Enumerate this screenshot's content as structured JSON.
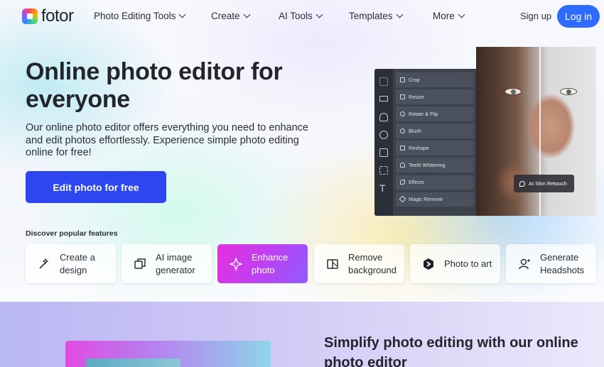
{
  "brand": {
    "name": "fotor"
  },
  "nav": {
    "items": [
      {
        "label": "Photo Editing Tools"
      },
      {
        "label": "Create"
      },
      {
        "label": "AI Tools"
      },
      {
        "label": "Templates"
      },
      {
        "label": "More"
      }
    ],
    "signup": "Sign up",
    "login": "Log in"
  },
  "hero": {
    "title": "Online photo editor for everyone",
    "description": "Our online photo editor offers everything you need to enhance and edit photos effortlessly. Experience simple photo editing online for free!",
    "cta": "Edit photo for free"
  },
  "editor": {
    "tools": [
      "Crop",
      "Resize",
      "Rotate & Flip",
      "Blush",
      "Reshape",
      "Teeth Whitening",
      "Effects",
      "Magic Remove"
    ],
    "badge": "AI Skin Retouch"
  },
  "features": {
    "heading": "Discover popular features",
    "items": [
      {
        "label": "Create a design",
        "icon": "magic-wand-icon",
        "active": false
      },
      {
        "label": "AI image generator",
        "icon": "image-stack-icon",
        "active": false
      },
      {
        "label": "Enhance photo",
        "icon": "sparkle-icon",
        "active": true
      },
      {
        "label": "Remove background",
        "icon": "remove-bg-icon",
        "active": false
      },
      {
        "label": "Photo to art",
        "icon": "art-icon",
        "active": false
      },
      {
        "label": "Generate Headshots",
        "icon": "headshot-icon",
        "active": false
      }
    ]
  },
  "section2": {
    "title": "Simplify photo editing with our online photo editor"
  },
  "colors": {
    "primary": "#2f6bff",
    "cta": "#2d46f0",
    "accent_gradient_start": "#e62fdc",
    "accent_gradient_end": "#8f5cff"
  }
}
